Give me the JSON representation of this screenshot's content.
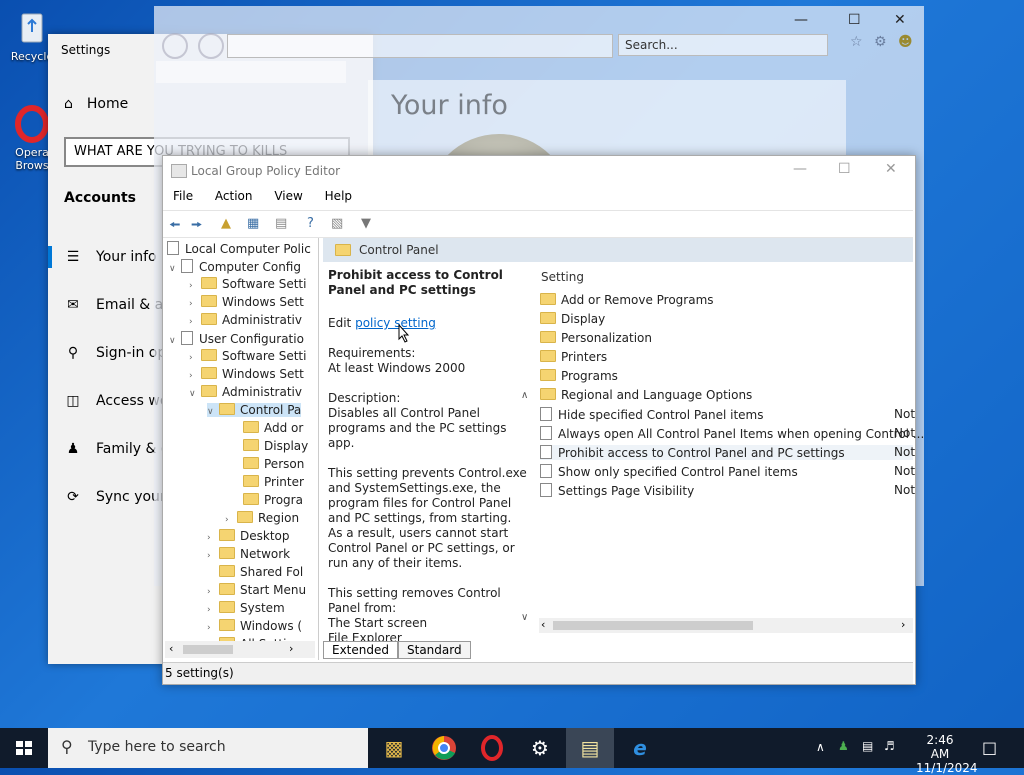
{
  "desktop": {
    "icons": [
      {
        "label": "Recycle",
        "icon": "recycle-bin-icon"
      },
      {
        "label": "Opera Brows",
        "icon": "opera-icon"
      }
    ]
  },
  "settings": {
    "title": "Settings",
    "home": "Home",
    "search_value": "WHAT ARE YOU TRYING TO KILLS",
    "section": "Accounts",
    "nav": [
      "Your info",
      "Email & ac",
      "Sign-in opt",
      "Access wor",
      "Family & o",
      "Sync your s"
    ]
  },
  "ie": {
    "search_placeholder": "Search...",
    "page_heading": "Your info"
  },
  "gpe": {
    "title": "Local Group Policy Editor",
    "menu": [
      "File",
      "Action",
      "View",
      "Help"
    ],
    "tree": [
      "Local Computer Polic",
      "Computer Config",
      "Software Setti",
      "Windows Sett",
      "Administrativ",
      "User Configuratio",
      "Software Setti",
      "Windows Sett",
      "Administrativ",
      "Control Pa",
      "Add or",
      "Display",
      "Person",
      "Printer",
      "Progra",
      "Region",
      "Desktop",
      "Network",
      "Shared Fol",
      "Start Menu",
      "System",
      "Windows (",
      "All Settin"
    ],
    "header_title": "Control Panel",
    "desc": {
      "title": "Prohibit access to Control Panel and PC settings",
      "edit_prefix": "Edit",
      "edit_link": "policy setting",
      "req_label": "Requirements:",
      "req_value": "At least Windows 2000",
      "desc_label": "Description:",
      "desc_p1": "Disables all Control Panel programs and the PC settings app.",
      "desc_p2": "This setting prevents Control.exe and SystemSettings.exe, the program files for Control Panel and PC settings, from starting. As a result, users cannot start Control Panel or PC settings, or run any of their items.",
      "desc_p3a": "This setting removes Control",
      "desc_p3b": "Panel from:",
      "desc_p3c": "The Start screen",
      "desc_p3d": "File Explorer"
    },
    "column_setting": "Setting",
    "folders": [
      "Add or Remove Programs",
      "Display",
      "Personalization",
      "Printers",
      "Programs",
      "Regional and Language Options"
    ],
    "policies": [
      {
        "name": "Hide specified Control Panel items",
        "state": "Not"
      },
      {
        "name": "Always open All Control Panel Items when opening Control ...",
        "state": "Not"
      },
      {
        "name": "Prohibit access to Control Panel and PC settings",
        "state": "Not"
      },
      {
        "name": "Show only specified Control Panel items",
        "state": "Not"
      },
      {
        "name": "Settings Page Visibility",
        "state": "Not"
      }
    ],
    "tabs": [
      "Extended",
      "Standard"
    ],
    "status": "5 setting(s)"
  },
  "taskbar": {
    "search_placeholder": "Type here to search",
    "time": "2:46 AM",
    "date": "11/1/2024"
  },
  "colors": {
    "accent": "#0078d7",
    "taskbar": "#101b2b",
    "link": "#0066cc"
  }
}
